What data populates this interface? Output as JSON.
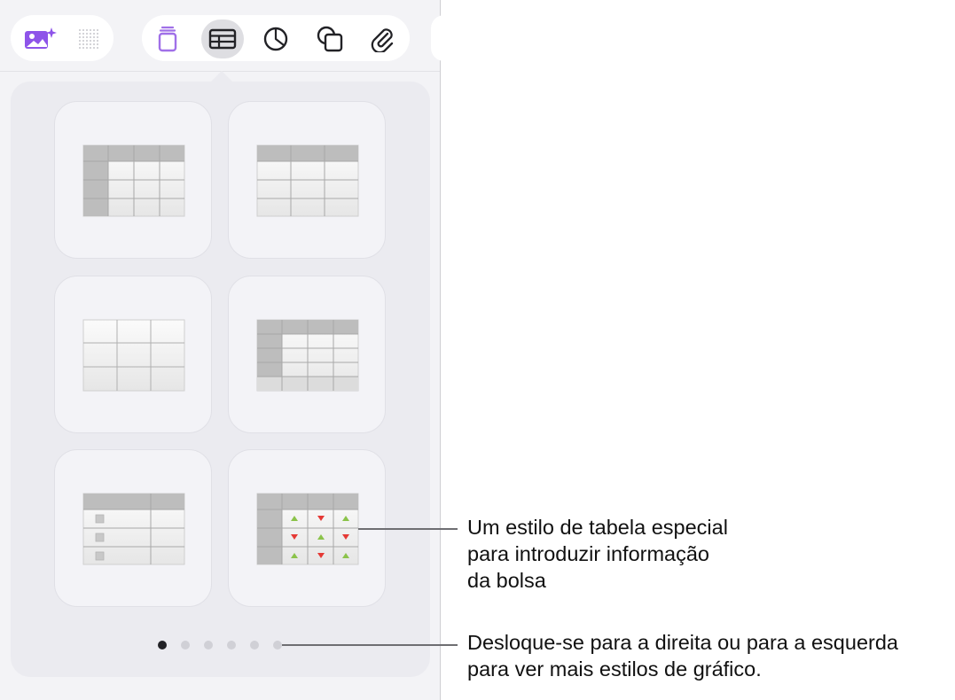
{
  "toolbar": {
    "left_buttons": [
      {
        "icon": "image-sparkle-icon",
        "color": "#8e54e9"
      },
      {
        "icon": "dot-grid-icon",
        "color": "#c7c7cc"
      }
    ],
    "main_buttons": [
      {
        "icon": "text-box-icon",
        "color": "#a070e8",
        "selected": false
      },
      {
        "icon": "table-icon",
        "color": "#222226",
        "selected": true
      },
      {
        "icon": "chart-icon",
        "color": "#222226",
        "selected": false
      },
      {
        "icon": "shape-icon",
        "color": "#222226",
        "selected": false
      },
      {
        "icon": "attachment-icon",
        "color": "#222226",
        "selected": false
      }
    ]
  },
  "styles": [
    {
      "name": "header-row-and-column"
    },
    {
      "name": "header-row"
    },
    {
      "name": "plain"
    },
    {
      "name": "header-row-column-footer"
    },
    {
      "name": "checklist"
    },
    {
      "name": "stock"
    }
  ],
  "pager": {
    "count": 6,
    "active": 0
  },
  "callouts": {
    "stock_table": "Um estilo de tabela especial\npara introduzir informação\nda bolsa",
    "pager": "Desloque-se para a direita ou para a esquerda\npara ver mais estilos de gráfico."
  },
  "colors": {
    "accent": "#8e54e9",
    "up": "#8bc34a",
    "down": "#e53935"
  }
}
